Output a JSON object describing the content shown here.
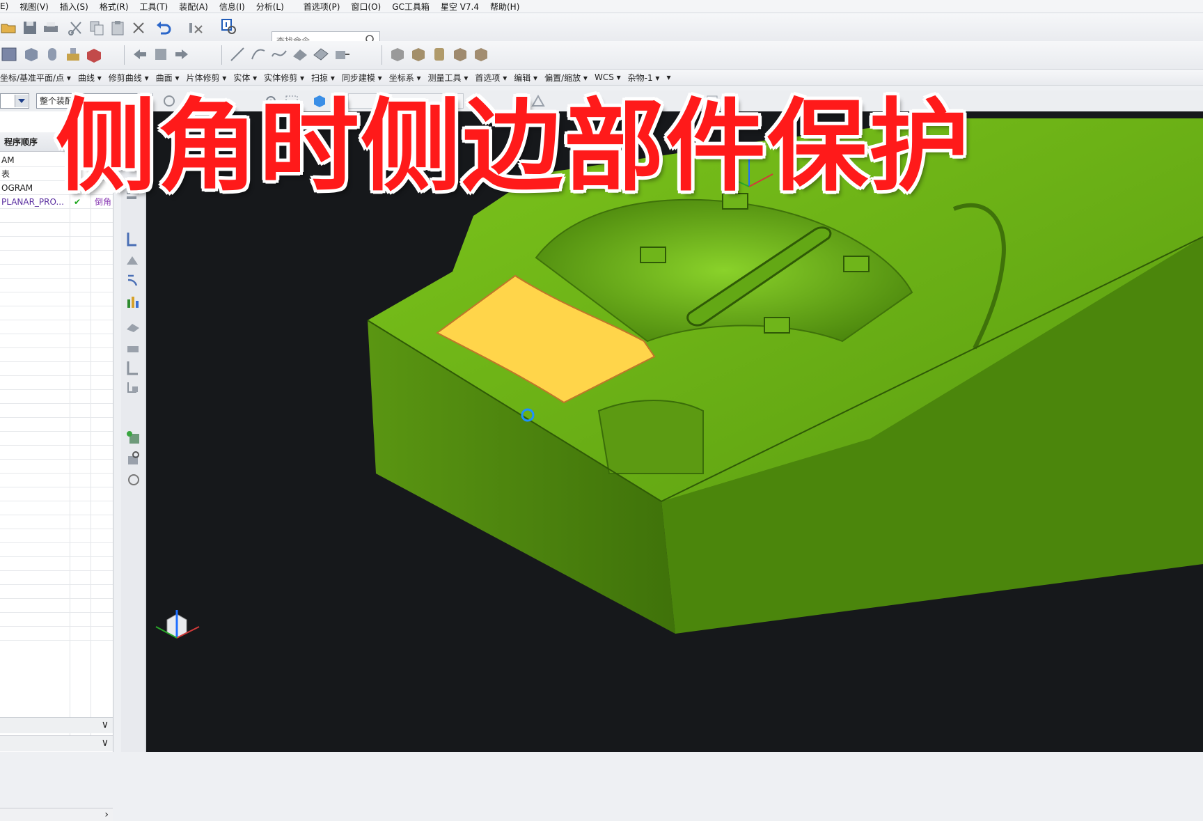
{
  "menu": {
    "items": [
      "E)",
      "视图(V)",
      "插入(S)",
      "格式(R)",
      "工具(T)",
      "装配(A)",
      "信息(I)",
      "分析(L)",
      "首选项(P)",
      "窗口(O)",
      "GC工具箱",
      "星空 V7.4",
      "帮助(H)"
    ]
  },
  "search": {
    "placeholder": "查找命令"
  },
  "ribbon": {
    "items": [
      "坐标/基准平面/点 ▾",
      "曲线 ▾",
      "修剪曲线 ▾",
      "曲面 ▾",
      "片体修剪 ▾",
      "实体 ▾",
      "实体修剪 ▾",
      "扫掠 ▾",
      "同步建模 ▾",
      "坐标系 ▾",
      "测量工具 ▾",
      "首选项 ▾",
      "编辑 ▾",
      "偏置/缩放 ▾",
      "WCS ▾",
      "杂物-1 ▾",
      "▾"
    ]
  },
  "selection": {
    "filter_value": "整个装配"
  },
  "navigator": {
    "header": "程序顺序",
    "rows": [
      {
        "name": "AM",
        "check": "",
        "extra": ""
      },
      {
        "name": "表",
        "check": "",
        "extra": ""
      },
      {
        "name": "OGRAM",
        "check": "",
        "extra": ""
      },
      {
        "name": "PLANAR_PRO...",
        "check": "✔",
        "extra": "倒角"
      }
    ],
    "scroll_arrow": "›",
    "chevron_1": "∨",
    "chevron_2": "∨"
  },
  "overlay": {
    "title": "侧角时侧边部件保护"
  },
  "colors": {
    "part_green": "#5da512",
    "highlight_face": "#ffd54a",
    "viewport_bg": "#16181b",
    "title_red": "#ff1a1a"
  }
}
